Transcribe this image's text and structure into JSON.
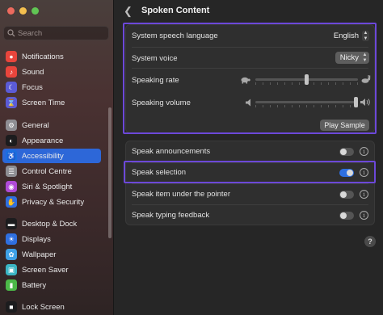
{
  "window": {
    "traffic_lights": [
      "#ed6a5e",
      "#f4bf4f",
      "#61c554"
    ]
  },
  "sidebar": {
    "search_placeholder": "Search",
    "items": [
      {
        "label": "Notifications",
        "icon": "bell-icon",
        "color": "#e8453c",
        "glyph": "●"
      },
      {
        "label": "Sound",
        "icon": "speaker-icon",
        "color": "#e8453c",
        "glyph": "♪"
      },
      {
        "label": "Focus",
        "icon": "moon-icon",
        "color": "#5b5bd6",
        "glyph": "☾"
      },
      {
        "label": "Screen Time",
        "icon": "hourglass-icon",
        "color": "#5b5bd6",
        "glyph": "⌛"
      },
      {
        "label": "General",
        "icon": "gear-icon",
        "color": "#8e8e93",
        "glyph": "⚙"
      },
      {
        "label": "Appearance",
        "icon": "appearance-icon",
        "color": "#1c1c1e",
        "glyph": "◐"
      },
      {
        "label": "Accessibility",
        "icon": "accessibility-icon",
        "color": "#1a6fe0",
        "glyph": "♿",
        "selected": true
      },
      {
        "label": "Control Centre",
        "icon": "control-centre-icon",
        "color": "#8e8e93",
        "glyph": "☰"
      },
      {
        "label": "Siri & Spotlight",
        "icon": "siri-icon",
        "color": "#b04ad6",
        "glyph": "◉"
      },
      {
        "label": "Privacy & Security",
        "icon": "hand-icon",
        "color": "#2f6fe0",
        "glyph": "✋"
      },
      {
        "label": "Desktop & Dock",
        "icon": "dock-icon",
        "color": "#1c1c1e",
        "glyph": "▬"
      },
      {
        "label": "Displays",
        "icon": "sun-icon",
        "color": "#2f6fe0",
        "glyph": "☀"
      },
      {
        "label": "Wallpaper",
        "icon": "flower-icon",
        "color": "#3ea0e6",
        "glyph": "✿"
      },
      {
        "label": "Screen Saver",
        "icon": "screen-saver-icon",
        "color": "#3bb6c4",
        "glyph": "▣"
      },
      {
        "label": "Battery",
        "icon": "battery-icon",
        "color": "#4bb847",
        "glyph": "▮"
      },
      {
        "label": "Lock Screen",
        "icon": "lock-icon",
        "color": "#1c1c1e",
        "glyph": "■"
      }
    ]
  },
  "main": {
    "title": "Spoken Content",
    "settings": {
      "language_label": "System speech language",
      "language_value": "English",
      "voice_label": "System voice",
      "voice_value": "Nicky",
      "rate_label": "Speaking rate",
      "rate_value": 0.5,
      "volume_label": "Speaking volume",
      "volume_value": 1.0,
      "play_sample": "Play Sample"
    },
    "toggles": [
      {
        "label": "Speak announcements",
        "on": false
      },
      {
        "label": "Speak selection",
        "on": true
      },
      {
        "label": "Speak item under the pointer",
        "on": false
      },
      {
        "label": "Speak typing feedback",
        "on": false
      }
    ],
    "help": "?"
  },
  "accent": "#2d67d8",
  "highlight_color": "#6c48d9"
}
